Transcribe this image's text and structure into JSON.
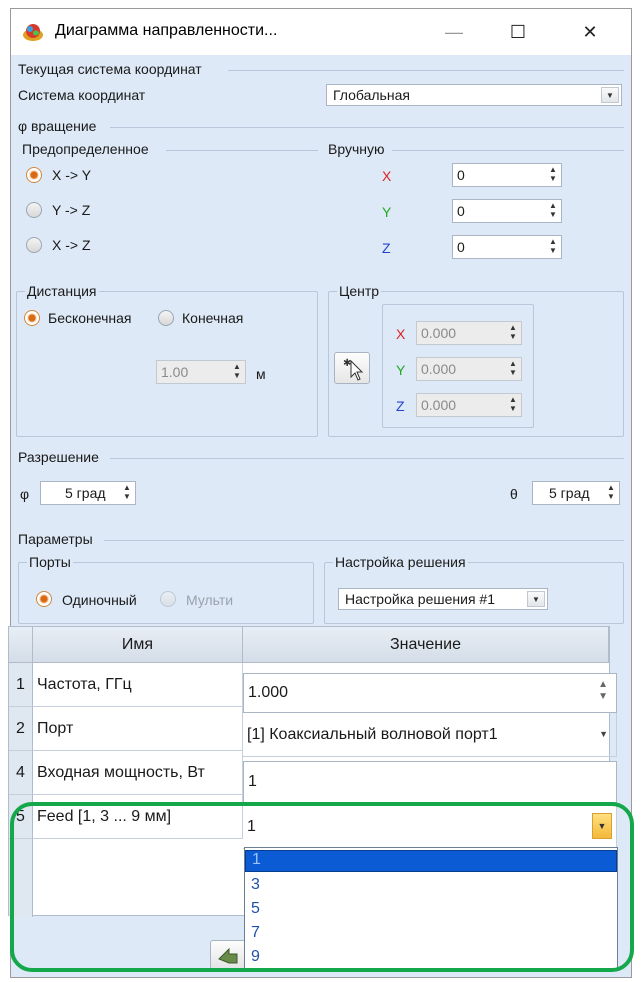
{
  "window": {
    "title": "Диаграмма направленности...",
    "minimize_label": "—",
    "maximize_label": "☐",
    "close_label": "✕"
  },
  "coords": {
    "section_title": "Текущая система координат",
    "system_label": "Система координат",
    "system_value": "Глобальная"
  },
  "rotation": {
    "section_title": "φ вращение",
    "predefined_title": "Предопределенное",
    "manual_title": "Вручную",
    "options": [
      "X -> Y",
      "Y -> Z",
      "X -> Z"
    ],
    "selected": "X -> Y",
    "axes": [
      {
        "axis": "X",
        "value": "0"
      },
      {
        "axis": "Y",
        "value": "0"
      },
      {
        "axis": "Z",
        "value": "0"
      }
    ]
  },
  "distance": {
    "title": "Дистанция",
    "infinite_label": "Бесконечная",
    "finite_label": "Конечная",
    "selected": "Бесконечная",
    "value": "1.00",
    "unit": "м"
  },
  "center": {
    "title": "Центр",
    "axes": [
      {
        "axis": "X",
        "value": "0.000"
      },
      {
        "axis": "Y",
        "value": "0.000"
      },
      {
        "axis": "Z",
        "value": "0.000"
      }
    ]
  },
  "resolution": {
    "title": "Разрешение",
    "phi_label": "φ",
    "phi_value": "5 град",
    "theta_label": "θ",
    "theta_value": "5 град"
  },
  "params": {
    "title": "Параметры",
    "ports_title": "Порты",
    "single_label": "Одиночный",
    "multi_label": "Мульти",
    "selected": "Одиночный",
    "solution_title": "Настройка решения",
    "solution_value": "Настройка решения #1"
  },
  "table": {
    "columns": [
      "Имя",
      "Значение"
    ],
    "rows": [
      {
        "num": "1",
        "name": "Частота, ГГц",
        "value": "1.000"
      },
      {
        "num": "2",
        "name": "Порт",
        "value": "[1] Коаксиальный волновой порт1"
      },
      {
        "num": "4",
        "name": "Входная мощность, Вт",
        "value": "1"
      },
      {
        "num": "5",
        "name": "Feed [1, 3 ... 9 мм]",
        "value": "1"
      }
    ]
  },
  "dropdown": {
    "options": [
      "1",
      "3",
      "5",
      "7",
      "9"
    ],
    "selected": "1"
  },
  "colors": {
    "accent_orange": "#d86a16",
    "highlight_green": "#14a84a",
    "selection_blue": "#0a5bd4"
  }
}
